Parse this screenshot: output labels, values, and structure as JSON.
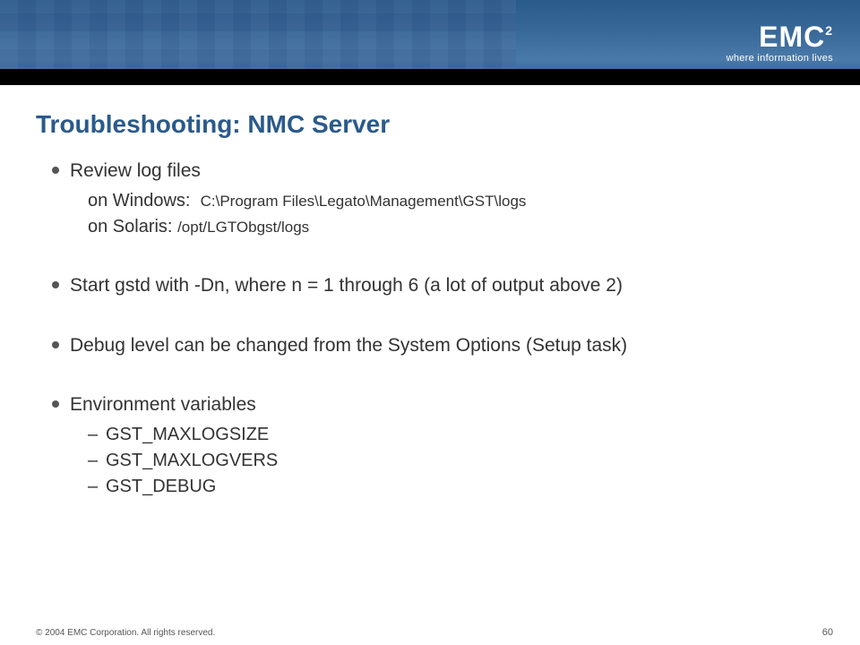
{
  "header": {
    "logo": "EMC",
    "logo_exponent": "2",
    "tagline": "where information lives"
  },
  "title": "Troubleshooting: NMC Server",
  "bullets": {
    "b1": {
      "text": "Review log files",
      "sub1_label": "on Windows:",
      "sub1_path": "C:\\Program Files\\Legato\\Management\\GST\\logs",
      "sub2_label": "on Solaris:",
      "sub2_path": "/opt/LGTObgst/logs"
    },
    "b2": {
      "text": "Start gstd with -Dn, where n = 1 through 6 (a lot of output above 2)"
    },
    "b3": {
      "text": "Debug level can be changed from the System Options (Setup task)"
    },
    "b4": {
      "text": "Environment variables",
      "env1": "GST_MAXLOGSIZE",
      "env2": "GST_MAXLOGVERS",
      "env3": "GST_DEBUG"
    }
  },
  "footer": {
    "copyright": "© 2004 EMC Corporation. All rights reserved.",
    "page": "60"
  }
}
